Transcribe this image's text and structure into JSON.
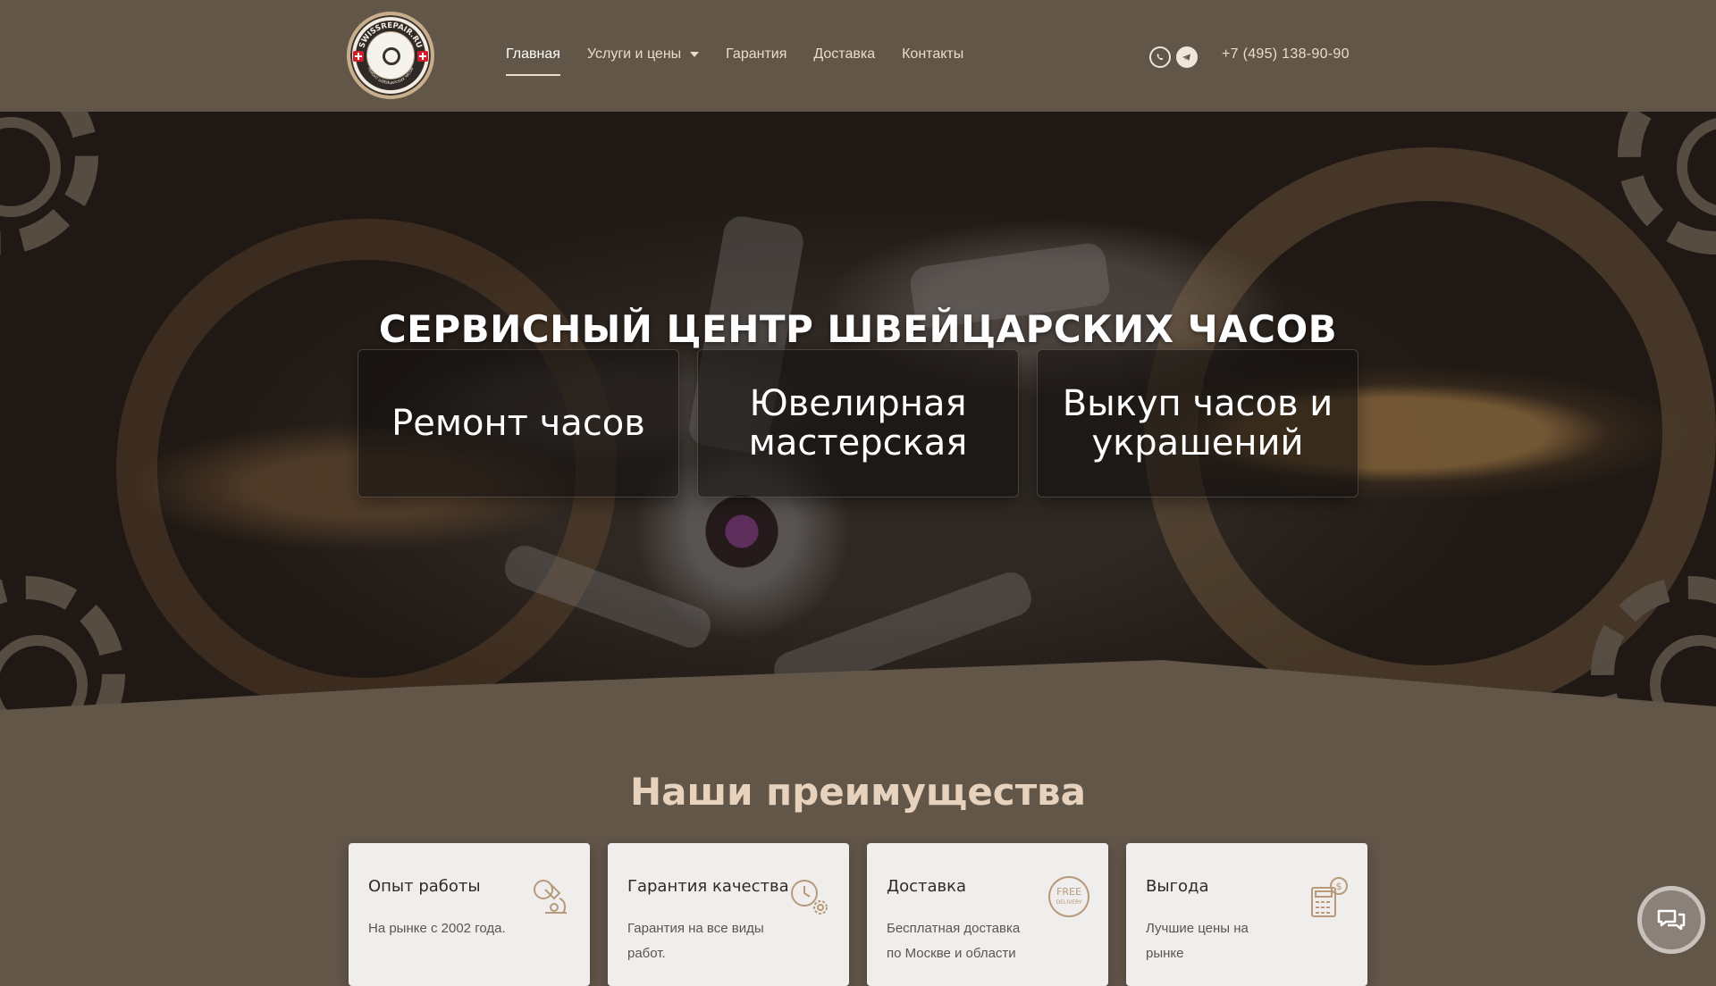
{
  "header": {
    "logo_text": "SWISSREPAIR.RU",
    "logo_subtext": "РЕМОНТ ШВЕЙЦАРСКИХ ЧАСОВ",
    "nav": [
      {
        "label": "Главная",
        "active": true
      },
      {
        "label": "Услуги и цены",
        "active": false,
        "has_dropdown": true
      },
      {
        "label": "Гарантия",
        "active": false
      },
      {
        "label": "Доставка",
        "active": false
      },
      {
        "label": "Контакты",
        "active": false
      }
    ],
    "social_icons": [
      "whatsapp-icon",
      "telegram-icon"
    ],
    "phone": "+7 (495) 138-90-90"
  },
  "hero": {
    "title": "СЕРВИСНЫЙ ЦЕНТР ШВЕЙЦАРСКИХ ЧАСОВ",
    "cards": [
      {
        "label": "Ремонт часов"
      },
      {
        "label": "Ювелирная мастерская"
      },
      {
        "label": "Выкуп часов и украшений"
      }
    ]
  },
  "advantages": {
    "title": "Наши преимущества",
    "items": [
      {
        "title": "Опыт работы",
        "text": "На рынке с 2002 года.",
        "icon": "microscope-icon"
      },
      {
        "title": "Гарантия качества",
        "text": "Гарантия на все виды работ.",
        "icon": "clock-gear-icon"
      },
      {
        "title": "Доставка",
        "text": "Бесплатная доставка по Москве и области",
        "icon": "free-delivery-icon",
        "icon_text": "FREE DELIVERY"
      },
      {
        "title": "Выгода",
        "text": "Лучшие цены на рынке",
        "icon": "calculator-dollar-icon"
      }
    ]
  },
  "colors": {
    "background": "#625649",
    "accent": "#e7d3bd",
    "card_bg": "#efeeed"
  },
  "chat_widget": {
    "icon": "chat-icon"
  }
}
